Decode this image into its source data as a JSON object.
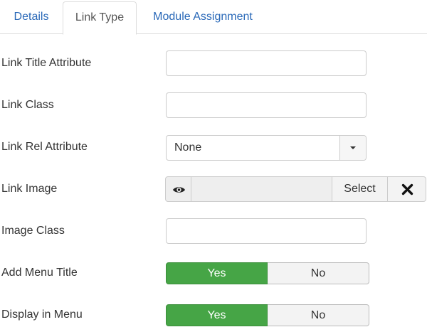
{
  "tabs": [
    {
      "label": "Details",
      "active": false
    },
    {
      "label": "Link Type",
      "active": true
    },
    {
      "label": "Module Assignment",
      "active": false
    }
  ],
  "form": {
    "link_title_attribute": {
      "label": "Link Title Attribute",
      "value": ""
    },
    "link_class": {
      "label": "Link Class",
      "value": ""
    },
    "link_rel_attribute": {
      "label": "Link Rel Attribute",
      "selected": "None"
    },
    "link_image": {
      "label": "Link Image",
      "select_label": "Select",
      "preview_icon": "eye-icon",
      "clear_icon": "close-icon"
    },
    "image_class": {
      "label": "Image Class",
      "value": ""
    },
    "add_menu_title": {
      "label": "Add Menu Title",
      "yes": "Yes",
      "no": "No",
      "selected": "Yes"
    },
    "display_in_menu": {
      "label": "Display in Menu",
      "yes": "Yes",
      "no": "No",
      "selected": "Yes"
    }
  },
  "colors": {
    "accent_link": "#2a69b8",
    "toggle_active": "#46a546"
  }
}
